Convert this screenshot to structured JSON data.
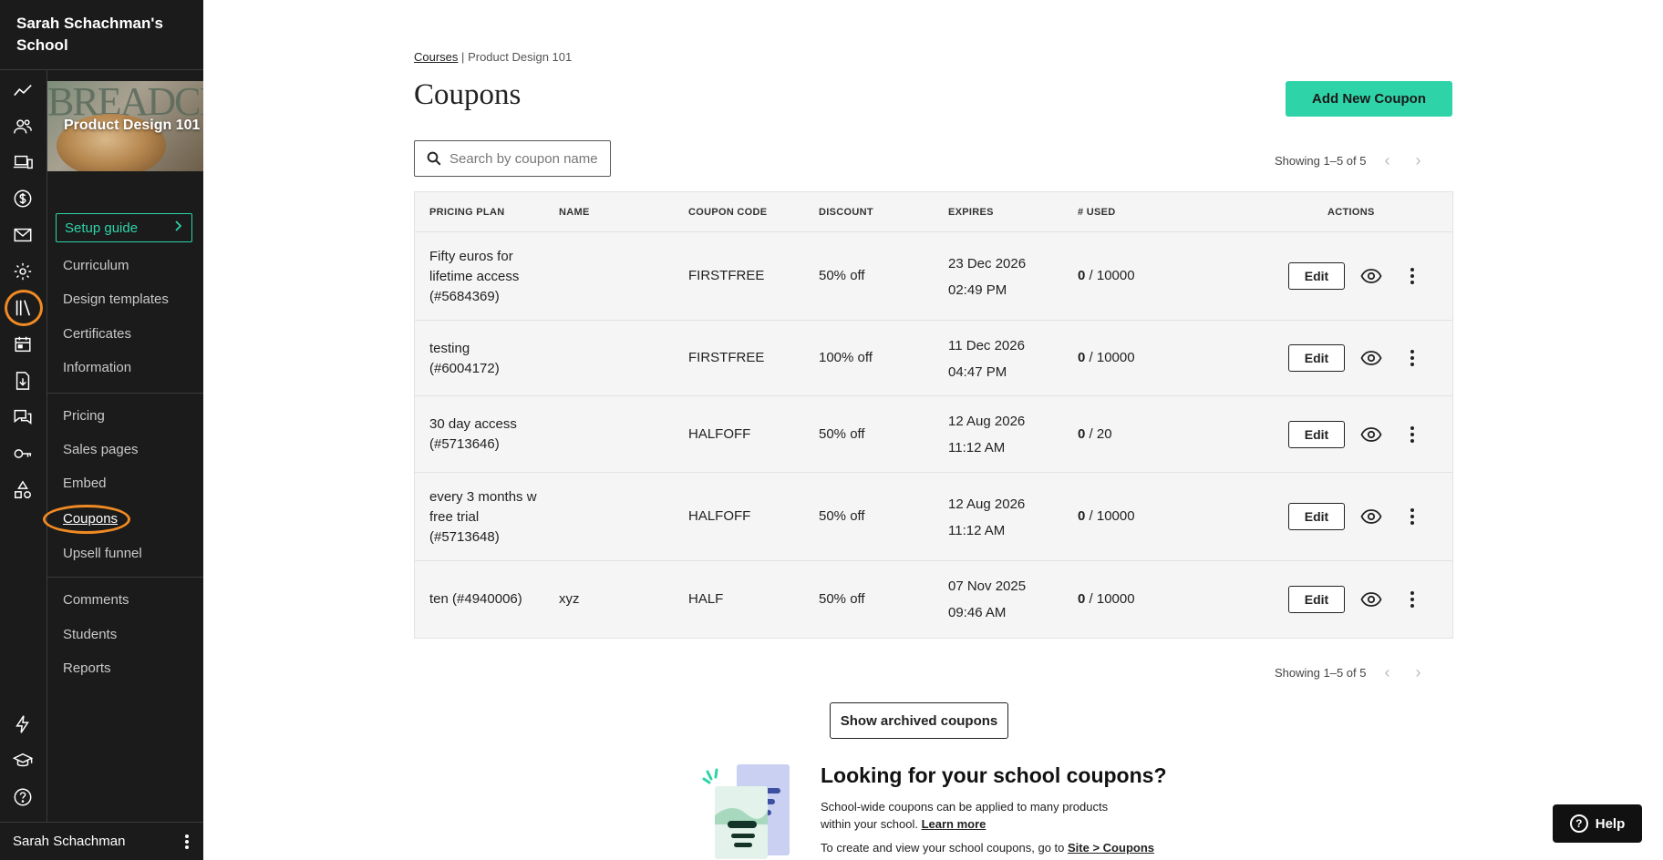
{
  "school": {
    "name": "Sarah Schachman's School"
  },
  "user": {
    "name": "Sarah Schachman"
  },
  "rail_icons": [
    "stats-icon",
    "users-icon",
    "devices-icon",
    "dollar-icon",
    "mail-icon",
    "gear-icon",
    "library-icon",
    "calendar-icon",
    "download-icon",
    "chat-icon",
    "key-icon",
    "shapes-icon",
    "lightning-icon",
    "graduation-cap-icon",
    "help-circle-icon"
  ],
  "course": {
    "thumb_word": "BREADCIPES",
    "title": "Product Design 101"
  },
  "sidebar": {
    "setup_guide": "Setup guide",
    "group1": [
      "Curriculum",
      "Design templates",
      "Certificates",
      "Information"
    ],
    "group2": [
      "Pricing",
      "Sales pages",
      "Embed",
      "Coupons",
      "Upsell funnel"
    ],
    "group3": [
      "Comments",
      "Students",
      "Reports"
    ],
    "active": "Coupons"
  },
  "breadcrumb": {
    "root": "Courses",
    "separator": "|",
    "current": "Product Design 101"
  },
  "page_title": "Coupons",
  "add_button": "Add New Coupon",
  "search": {
    "placeholder": "Search by coupon name"
  },
  "pagination": {
    "label": "Showing 1–5 of 5"
  },
  "table": {
    "headers": [
      "PRICING PLAN",
      "NAME",
      "COUPON CODE",
      "DISCOUNT",
      "EXPIRES",
      "# USED",
      "ACTIONS"
    ],
    "rows": [
      {
        "plan": "Fifty euros for lifetime access (#5684369)",
        "name": "",
        "code": "FIRSTFREE",
        "discount": "50% off",
        "expires_date": "23 Dec 2026",
        "expires_time": "02:49 PM",
        "used": "0",
        "limit": " / 10000"
      },
      {
        "plan": "testing (#6004172)",
        "name": "",
        "code": "FIRSTFREE",
        "discount": "100% off",
        "expires_date": "11 Dec 2026",
        "expires_time": "04:47 PM",
        "used": "0",
        "limit": " / 10000"
      },
      {
        "plan": "30 day access (#5713646)",
        "name": "",
        "code": "HALFOFF",
        "discount": "50% off",
        "expires_date": "12 Aug 2026",
        "expires_time": "11:12 AM",
        "used": "0",
        "limit": " / 20"
      },
      {
        "plan": "every 3 months w free trial (#5713648)",
        "name": "",
        "code": "HALFOFF",
        "discount": "50% off",
        "expires_date": "12 Aug 2026",
        "expires_time": "11:12 AM",
        "used": "0",
        "limit": " / 10000"
      },
      {
        "plan": "ten (#4940006)",
        "name": "xyz",
        "code": "HALF",
        "discount": "50% off",
        "expires_date": "07 Nov 2025",
        "expires_time": "09:46 AM",
        "used": "0",
        "limit": " / 10000"
      }
    ],
    "edit_label": "Edit"
  },
  "archived_button": "Show archived coupons",
  "promo": {
    "title": "Looking for your school coupons?",
    "text": "School-wide coupons can be applied to many products within your school.",
    "learn_more": "Learn more",
    "text2": "To create and view your school coupons, go to",
    "link2": "Site > Coupons"
  },
  "help_button": "Help",
  "colors": {
    "accent": "#2ed3a8",
    "highlight": "#f08a24",
    "sidebar_bg": "#1b1b1b"
  }
}
